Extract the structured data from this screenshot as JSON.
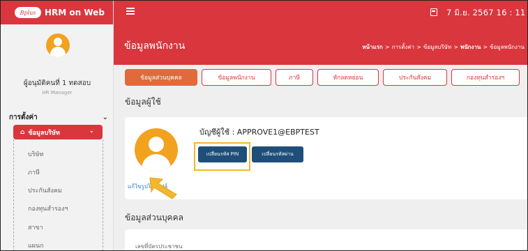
{
  "app": {
    "name": "HRM on Web",
    "logo_text": "Bplus"
  },
  "header": {
    "datetime": "7 มิ.ย. 2567  16 : 11 : 06"
  },
  "user": {
    "name": "ผู้อนุมัติคนที่ 1 ทดสอบ",
    "role": "HR Manager"
  },
  "sidebar": {
    "section_label": "การตั้งค่า",
    "active_item": "ข้อมูลบริษัท",
    "sub_items": [
      "บริษัท",
      "ภาษี",
      "ประกันสังคม",
      "กองทุนสำรองฯ",
      "สาขา",
      "แผนก"
    ]
  },
  "page": {
    "title": "ข้อมูลพนักงาน",
    "breadcrumb": [
      "หน้าแรก",
      "การตั้งค่า",
      "ข้อมูลบริษัท",
      "พนักงาน",
      "ข้อมูลพนักงาน"
    ]
  },
  "tabs": [
    "ข้อมูลส่วนบุคคล",
    "ข้อมูลพนักงาน",
    "ภาษี",
    "หักลดหย่อน",
    "ประกันสังคม",
    "กองทุนสำรองฯ"
  ],
  "user_info": {
    "section_title": "ข้อมูลผู้ใช้",
    "account_label": "บัญชีผู้ใช้ : APPROVE1@EBPTEST",
    "change_pin_button": "เปลี่ยนรหัส PIN",
    "change_password_button": "เปลี่ยนรหัสผ่าน",
    "edit_photo_link": "แก้ไขรูปโปรไฟล์"
  },
  "personal_info": {
    "section_title": "ข้อมูลส่วนบุคคล",
    "id_card_label": "เลขที่บัตรประชาชน"
  },
  "colors": {
    "primary": "#d9363e",
    "tab_active": "#e06a3c",
    "button": "#1f4e79",
    "highlight": "#f1b72e",
    "avatar": "#f2a21f"
  }
}
